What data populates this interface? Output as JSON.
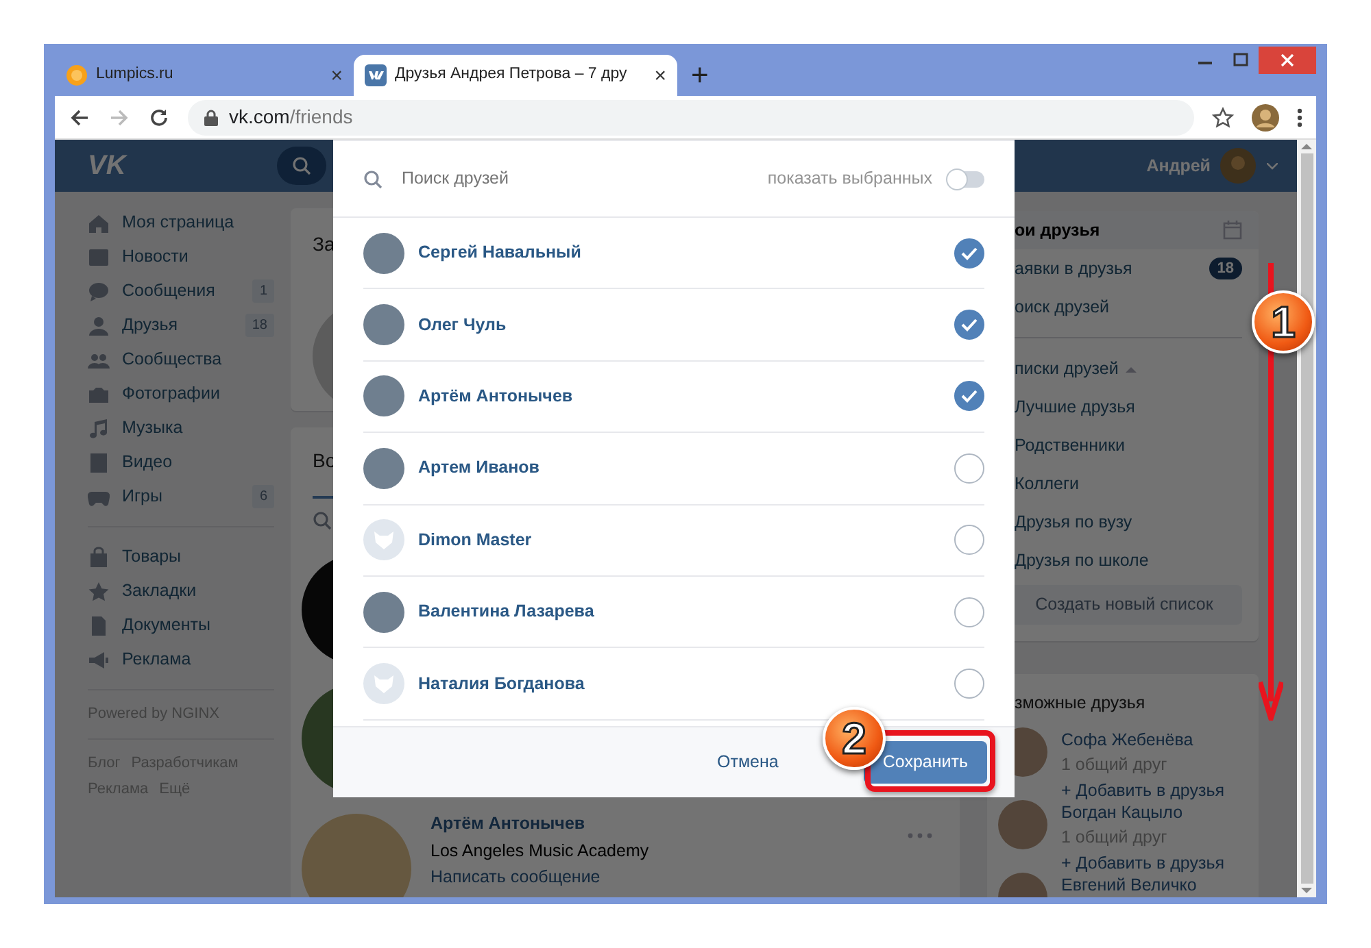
{
  "browser": {
    "tabs": [
      {
        "title": "Lumpics.ru",
        "kind": "orange",
        "close": "×",
        "selected": false
      },
      {
        "title": "Друзья Андрея Петрова – 7 дру",
        "kind": "vk",
        "close": "×",
        "selected": true
      }
    ],
    "new_tab": "+",
    "address": {
      "domain": "vk.com",
      "path": "/friends"
    }
  },
  "header": {
    "logo": "VK",
    "user_name": "Андрей"
  },
  "sidebar": {
    "groups": [
      [
        {
          "label": "Моя страница",
          "kind": "home"
        },
        {
          "label": "Новости",
          "kind": "news"
        },
        {
          "label": "Сообщения",
          "kind": "chat",
          "count": "1"
        },
        {
          "label": "Друзья",
          "kind": "person",
          "count": "18"
        },
        {
          "label": "Сообщества",
          "kind": "people"
        },
        {
          "label": "Фотографии",
          "kind": "camera"
        },
        {
          "label": "Музыка",
          "kind": "music"
        },
        {
          "label": "Видео",
          "kind": "film"
        },
        {
          "label": "Игры",
          "kind": "gamepad",
          "count": "6"
        }
      ],
      [
        {
          "label": "Товары",
          "kind": "bag"
        },
        {
          "label": "Закладки",
          "kind": "star"
        },
        {
          "label": "Документы",
          "kind": "doc"
        },
        {
          "label": "Реклама",
          "kind": "megaphone"
        }
      ]
    ],
    "powered": "Powered by NGINX",
    "links": [
      "Блог",
      "Разработчикам",
      "Реклама",
      "Ещё"
    ]
  },
  "main": {
    "card_title": "За",
    "tab": "Во",
    "friend": {
      "name": "Артём Антонычев",
      "info": "Los Angeles Music Academy",
      "action": "Написать сообщение"
    }
  },
  "modal": {
    "search": {
      "placeholder": "Поиск друзей"
    },
    "toggle": {
      "label": "показать выбранных",
      "on": false
    },
    "friends": [
      {
        "name": "Сергей Навальный",
        "kind": "photo",
        "selected": true
      },
      {
        "name": "Олег Чуль",
        "kind": "photo",
        "selected": true
      },
      {
        "name": "Артём Антонычев",
        "kind": "photo",
        "selected": true
      },
      {
        "name": "Артем Иванов",
        "kind": "photo",
        "selected": false
      },
      {
        "name": "Dimon Master",
        "kind": "default",
        "selected": false
      },
      {
        "name": "Валентина Лазарева",
        "kind": "photo",
        "selected": false
      },
      {
        "name": "Наталия Богданова",
        "kind": "default",
        "selected": false
      }
    ],
    "cancel": "Отмена",
    "save": "Сохранить"
  },
  "right": {
    "menu": [
      {
        "label": "ои друзья",
        "selected": true
      },
      {
        "label": "аявки в друзья",
        "count": "18",
        "selected": false
      },
      {
        "label": "оиск друзей",
        "selected": false
      }
    ],
    "lists_title": "писки друзей",
    "lists": [
      "Лучшие друзья",
      "Родственники",
      "Коллеги",
      "Друзья по вузу",
      "Друзья по школе"
    ],
    "create": "Создать новый список",
    "possible_title": "зможные друзья",
    "people": [
      {
        "name": "Софа Жебенёва",
        "mutual": "1 общий друг",
        "add": "+ Добавить в друзья"
      },
      {
        "name": "Богдан Кацыло",
        "mutual": "1 общий друг",
        "add": "+ Добавить в друзья"
      },
      {
        "name": "Евгений Величко"
      }
    ]
  },
  "annotations": [
    {
      "label": "1"
    },
    {
      "label": "2"
    }
  ]
}
